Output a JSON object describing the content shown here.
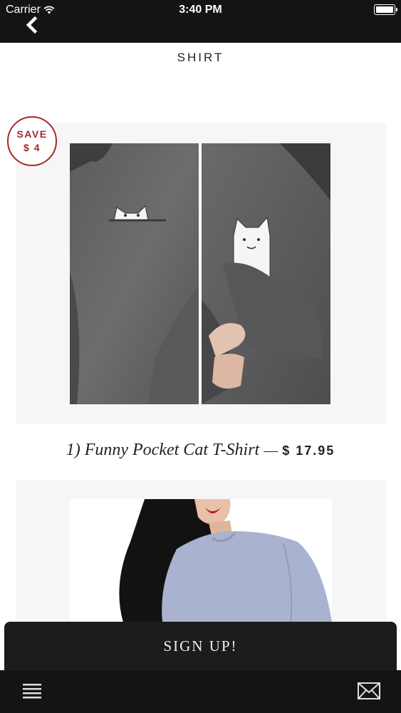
{
  "status_bar": {
    "carrier": "Carrier",
    "time": "3:40 PM"
  },
  "header": {
    "title": "SHIRT"
  },
  "products": [
    {
      "badge_line1": "SAVE",
      "badge_line2": "$ 4",
      "name": "1) Funny Pocket Cat T-Shirt",
      "dash": "—",
      "price": "$ 17.95"
    }
  ],
  "signup": {
    "label": "SIGN UP!"
  },
  "icons": {
    "back": "chevron-left-icon",
    "wifi": "wifi-icon",
    "battery": "battery-icon",
    "menu": "menu-icon",
    "mail": "mail-icon"
  },
  "colors": {
    "bar": "#141414",
    "badge": "#a52a2a",
    "card": "#f6f5f7"
  }
}
